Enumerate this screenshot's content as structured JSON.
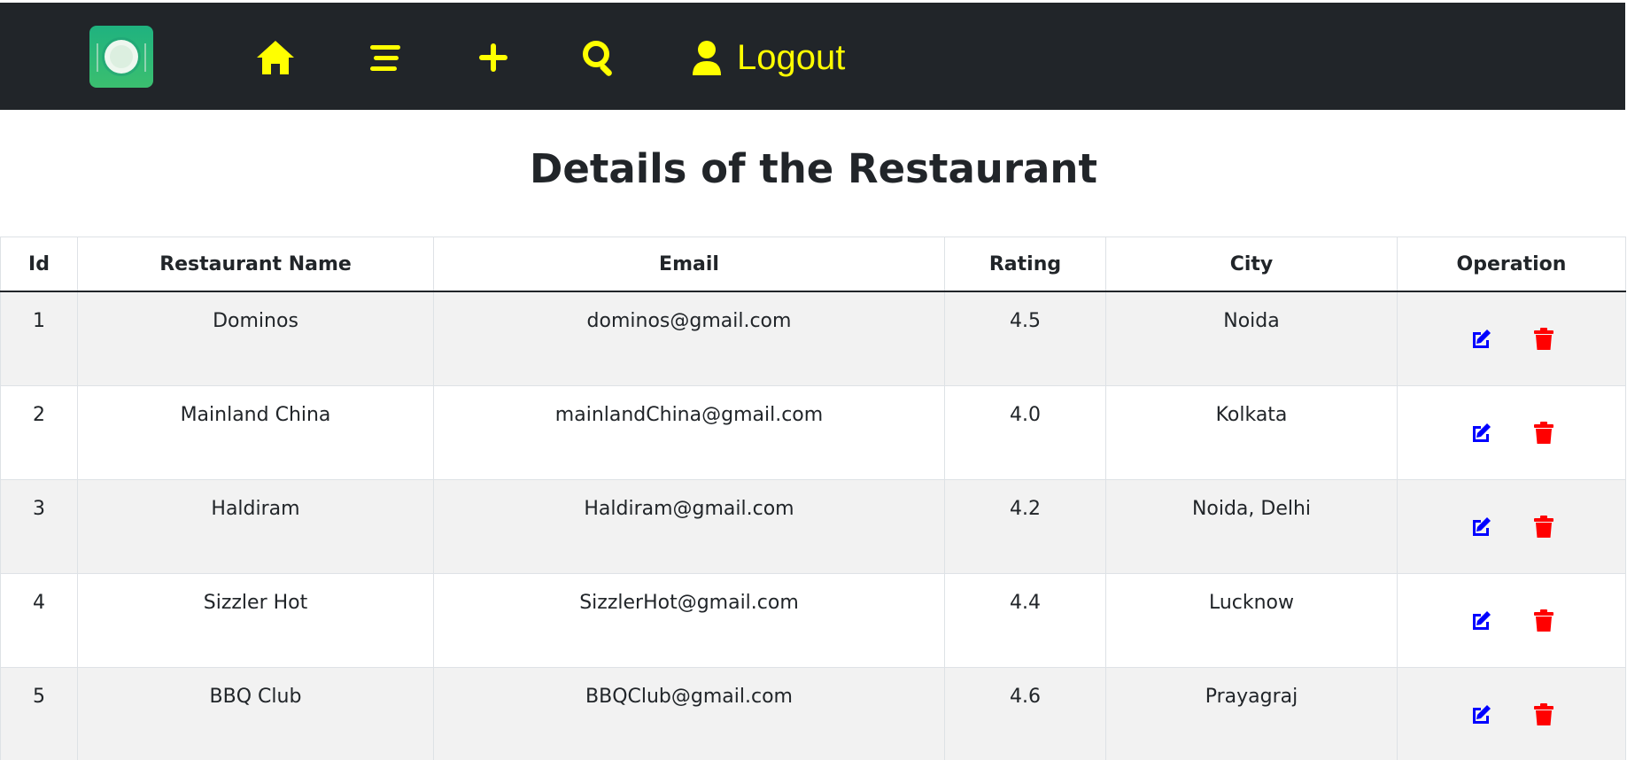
{
  "colors": {
    "navbar_bg": "#212529",
    "nav_accent": "#ffff00",
    "edit_icon": "#0000ff",
    "delete_icon": "#ff0000",
    "striped_row": "#f2f2f2",
    "logo_green": "#2ab977"
  },
  "navbar": {
    "logo_icon": "plate-logo-icon",
    "home_icon": "home-icon",
    "list_icon": "menu-list-icon",
    "add_icon": "plus-icon",
    "search_icon": "search-icon",
    "user_icon": "user-icon",
    "logout_label": "Logout"
  },
  "page": {
    "title": "Details of the Restaurant"
  },
  "table": {
    "headers": [
      "Id",
      "Restaurant Name",
      "Email",
      "Rating",
      "City",
      "Operation"
    ],
    "rows": [
      {
        "id": "1",
        "name": "Dominos",
        "email": "dominos@gmail.com",
        "rating": "4.5",
        "city": "Noida"
      },
      {
        "id": "2",
        "name": "Mainland China",
        "email": "mainlandChina@gmail.com",
        "rating": "4.0",
        "city": "Kolkata"
      },
      {
        "id": "3",
        "name": "Haldiram",
        "email": "Haldiram@gmail.com",
        "rating": "4.2",
        "city": "Noida, Delhi"
      },
      {
        "id": "4",
        "name": "Sizzler Hot",
        "email": "SizzlerHot@gmail.com",
        "rating": "4.4",
        "city": "Lucknow"
      },
      {
        "id": "5",
        "name": "BBQ Club",
        "email": "BBQClub@gmail.com",
        "rating": "4.6",
        "city": "Prayagraj"
      }
    ],
    "operation_icons": [
      "edit-icon",
      "trash-icon"
    ]
  }
}
